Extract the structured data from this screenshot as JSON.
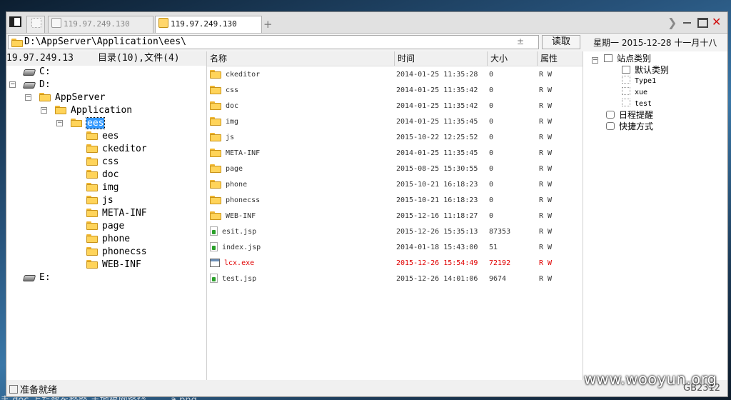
{
  "tabs": [
    {
      "label": ""
    },
    {
      "label": "119.97.249.130"
    },
    {
      "label": "119.97.249.130"
    }
  ],
  "address": {
    "path": "D:\\AppServer\\Application\\ees\\",
    "dropdown": "±",
    "read_label": "读取"
  },
  "date_display": "星期一 2015-12-28 十一月十八",
  "left_header": {
    "host": "19.97.249.13",
    "summary": "目录(10),文件(4)"
  },
  "tree": {
    "c_drive": "C:",
    "d_drive": "D:",
    "appserver": "AppServer",
    "application": "Application",
    "ees_selected": "ees",
    "children": [
      "ees",
      "ckeditor",
      "css",
      "doc",
      "img",
      "js",
      "META-INF",
      "page",
      "phone",
      "phonecss",
      "WEB-INF"
    ],
    "e_drive": "E:"
  },
  "columns": {
    "name": "名称",
    "time": "时间",
    "size": "大小",
    "attr": "属性"
  },
  "files": [
    {
      "name": "ckeditor",
      "time": "2014-01-25 11:35:28",
      "size": "0",
      "attr": "R W",
      "type": "folder"
    },
    {
      "name": "css",
      "time": "2014-01-25 11:35:42",
      "size": "0",
      "attr": "R W",
      "type": "folder"
    },
    {
      "name": "doc",
      "time": "2014-01-25 11:35:42",
      "size": "0",
      "attr": "R W",
      "type": "folder"
    },
    {
      "name": "img",
      "time": "2014-01-25 11:35:45",
      "size": "0",
      "attr": "R W",
      "type": "folder"
    },
    {
      "name": "js",
      "time": "2015-10-22 12:25:52",
      "size": "0",
      "attr": "R W",
      "type": "folder"
    },
    {
      "name": "META-INF",
      "time": "2014-01-25 11:35:45",
      "size": "0",
      "attr": "R W",
      "type": "folder"
    },
    {
      "name": "page",
      "time": "2015-08-25 15:30:55",
      "size": "0",
      "attr": "R W",
      "type": "folder"
    },
    {
      "name": "phone",
      "time": "2015-10-21 16:18:23",
      "size": "0",
      "attr": "R W",
      "type": "folder"
    },
    {
      "name": "phonecss",
      "time": "2015-10-21 16:18:23",
      "size": "0",
      "attr": "R W",
      "type": "folder"
    },
    {
      "name": "WEB-INF",
      "time": "2015-12-16 11:18:27",
      "size": "0",
      "attr": "R W",
      "type": "folder"
    },
    {
      "name": "esit.jsp",
      "time": "2015-12-26 15:35:13",
      "size": "87353",
      "attr": "R W",
      "type": "jsp"
    },
    {
      "name": "index.jsp",
      "time": "2014-01-18 15:43:00",
      "size": "51",
      "attr": "R W",
      "type": "jsp"
    },
    {
      "name": "lcx.exe",
      "time": "2015-12-26 15:54:49",
      "size": "72192",
      "attr": "R W",
      "type": "exe",
      "highlight": "#e00000"
    },
    {
      "name": "test.jsp",
      "time": "2015-12-26 14:01:06",
      "size": "9674",
      "attr": "R W",
      "type": "jsp"
    }
  ],
  "right_panel": {
    "site_category": "站点类别",
    "default_category": "默认类别",
    "type1": "Type1",
    "xue": "xue",
    "test": "test",
    "schedule": "日程提醒",
    "shortcuts": "快捷方式"
  },
  "status": {
    "text": "准备就绪",
    "encoding": "GB2312"
  },
  "watermark": "www.wooyun.org",
  "background_text": "ま doc 上た数を整整 丰地根网络绕 —— a.png"
}
